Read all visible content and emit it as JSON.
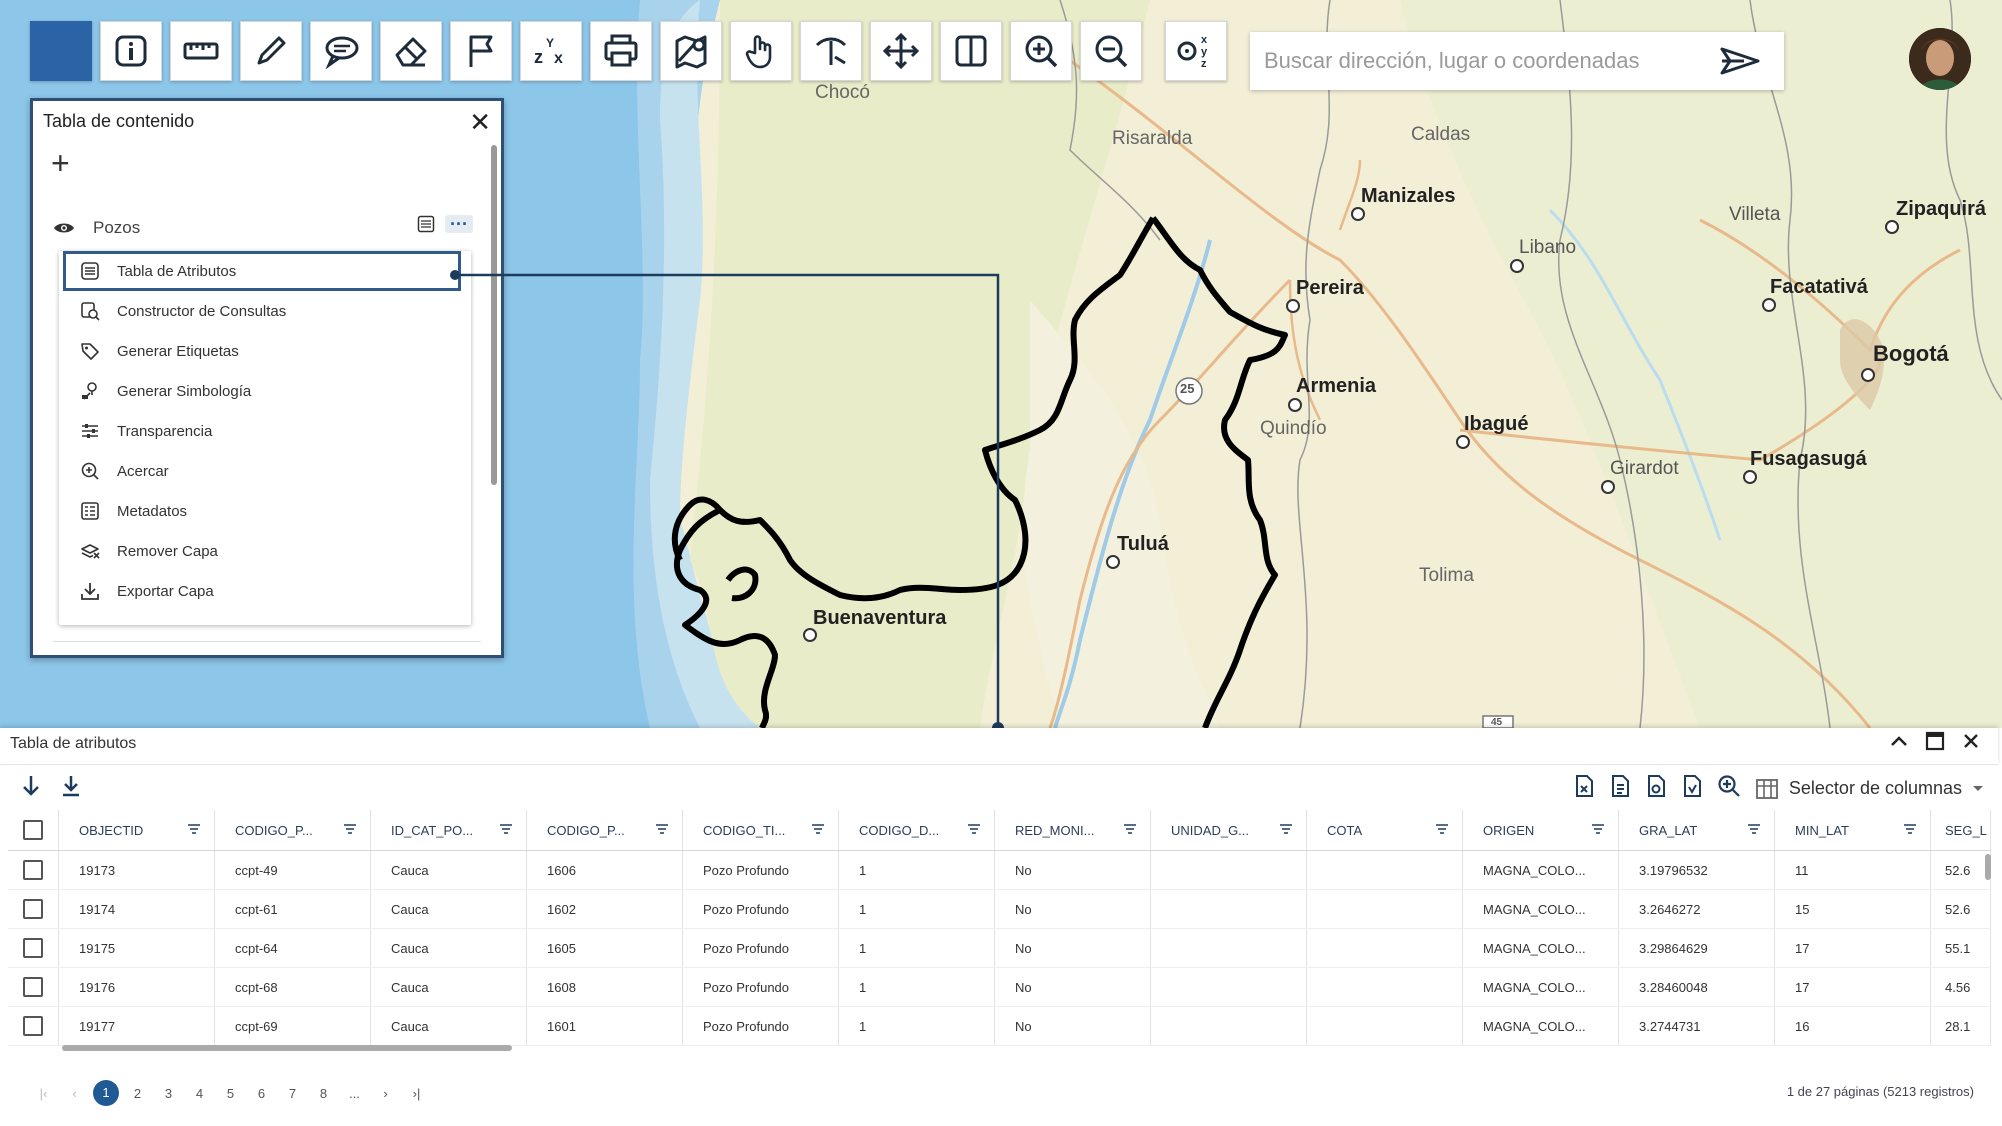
{
  "toolbar": {
    "tools": [
      {
        "name": "home-tool",
        "icon": "blank-square-icon"
      },
      {
        "name": "info-tool",
        "icon": "info-icon"
      },
      {
        "name": "measure-tool",
        "icon": "ruler-icon"
      },
      {
        "name": "draw-tool",
        "icon": "pencil-icon"
      },
      {
        "name": "annotation-tool",
        "icon": "speech-bubble-icon"
      },
      {
        "name": "erase-tool",
        "icon": "eraser-icon"
      },
      {
        "name": "bookmark-tool",
        "icon": "flag-icon"
      },
      {
        "name": "elevation-tool",
        "icon": "zxy-icon"
      },
      {
        "name": "print-tool",
        "icon": "printer-icon"
      },
      {
        "name": "map-compare-tool",
        "icon": "map-pin-icon"
      },
      {
        "name": "pan-tool",
        "icon": "hand-icon"
      },
      {
        "name": "coordinate-capture-tool",
        "icon": "pickaxe-icon"
      },
      {
        "name": "full-extent-tool",
        "icon": "arrows-icon"
      },
      {
        "name": "swipe-tool",
        "icon": "split-view-icon"
      },
      {
        "name": "zoom-in-tool",
        "icon": "zoom-in-icon"
      },
      {
        "name": "zoom-out-tool",
        "icon": "zoom-out-icon"
      },
      {
        "name": "xyz-locate-tool",
        "icon": "xyz-icon"
      }
    ],
    "accent": "#2c63a6"
  },
  "search": {
    "placeholder": "Buscar dirección, lugar o coordenadas"
  },
  "map": {
    "places": [
      {
        "label": "Chocó",
        "kind": "region"
      },
      {
        "label": "Risaralda",
        "kind": "region"
      },
      {
        "label": "Caldas",
        "kind": "region"
      },
      {
        "label": "Manizales",
        "kind": "city"
      },
      {
        "label": "Villeta",
        "kind": "town"
      },
      {
        "label": "Zipaquirá",
        "kind": "city"
      },
      {
        "label": "Libano",
        "kind": "town"
      },
      {
        "label": "Pereira",
        "kind": "city"
      },
      {
        "label": "Facatativá",
        "kind": "city"
      },
      {
        "label": "Bogotá",
        "kind": "city"
      },
      {
        "label": "Armenia",
        "kind": "city"
      },
      {
        "label": "Quindío",
        "kind": "region"
      },
      {
        "label": "Ibagué",
        "kind": "city"
      },
      {
        "label": "Fusagasugá",
        "kind": "city"
      },
      {
        "label": "Girardot",
        "kind": "town"
      },
      {
        "label": "Tuluá",
        "kind": "city"
      },
      {
        "label": "Tolima",
        "kind": "region"
      },
      {
        "label": "Buenaventura",
        "kind": "city"
      }
    ],
    "shields": [
      "25",
      "45"
    ]
  },
  "toc": {
    "title": "Tabla de contenido",
    "layer": {
      "name": "Pozos"
    },
    "menu": [
      {
        "label": "Tabla de Atributos",
        "icon": "table-icon",
        "selected": true
      },
      {
        "label": "Constructor de Consultas",
        "icon": "query-builder-icon"
      },
      {
        "label": "Generar Etiquetas",
        "icon": "tag-icon"
      },
      {
        "label": "Generar Simbología",
        "icon": "symbology-icon"
      },
      {
        "label": "Transparencia",
        "icon": "sliders-icon"
      },
      {
        "label": "Acercar",
        "icon": "zoom-in-icon"
      },
      {
        "label": "Metadatos",
        "icon": "metadata-icon"
      },
      {
        "label": "Remover Capa",
        "icon": "remove-layer-icon"
      },
      {
        "label": "Exportar Capa",
        "icon": "download-icon"
      }
    ]
  },
  "attr_table": {
    "title": "Tabla de atributos",
    "column_selector": "Selector de columnas",
    "columns": [
      "OBJECTID",
      "CODIGO_P...",
      "ID_CAT_PO...",
      "CODIGO_P...",
      "CODIGO_TI...",
      "CODIGO_D...",
      "RED_MONI...",
      "UNIDAD_G...",
      "COTA",
      "ORIGEN",
      "GRA_LAT",
      "MIN_LAT",
      "SEG_L"
    ],
    "rows": [
      [
        "19173",
        "ccpt-49",
        "Cauca",
        "1606",
        "Pozo Profundo",
        "1",
        "No",
        "",
        "",
        "MAGNA_COLO...",
        "3.19796532",
        "11",
        "52.6"
      ],
      [
        "19174",
        "ccpt-61",
        "Cauca",
        "1602",
        "Pozo Profundo",
        "1",
        "No",
        "",
        "",
        "MAGNA_COLO...",
        "3.2646272",
        "15",
        "52.6"
      ],
      [
        "19175",
        "ccpt-64",
        "Cauca",
        "1605",
        "Pozo Profundo",
        "1",
        "No",
        "",
        "",
        "MAGNA_COLO...",
        "3.29864629",
        "17",
        "55.1"
      ],
      [
        "19176",
        "ccpt-68",
        "Cauca",
        "1608",
        "Pozo Profundo",
        "1",
        "No",
        "",
        "",
        "MAGNA_COLO...",
        "3.28460048",
        "17",
        "4.56"
      ],
      [
        "19177",
        "ccpt-69",
        "Cauca",
        "1601",
        "Pozo Profundo",
        "1",
        "No",
        "",
        "",
        "MAGNA_COLO...",
        "3.2744731",
        "16",
        "28.1"
      ]
    ],
    "pager": {
      "pages": [
        "1",
        "2",
        "3",
        "4",
        "5",
        "6",
        "7",
        "8",
        "..."
      ],
      "current": "1",
      "info": "1 de 27 páginas (5213 registros)"
    }
  }
}
